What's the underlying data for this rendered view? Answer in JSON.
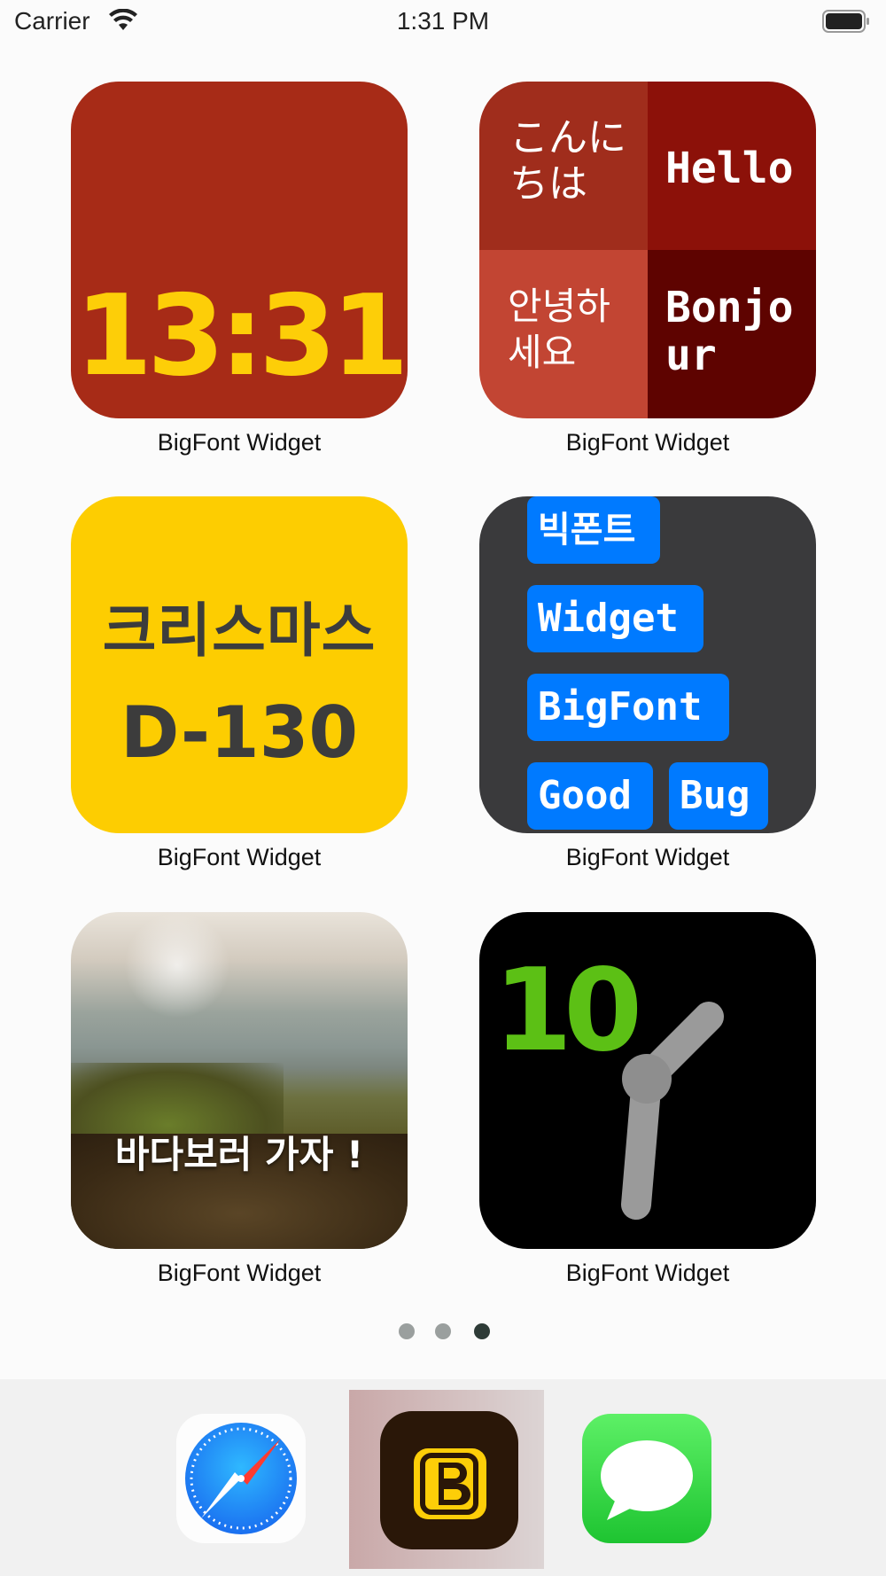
{
  "status_bar": {
    "carrier": "Carrier",
    "time": "1:31 PM"
  },
  "widgets": [
    {
      "label": "BigFont Widget",
      "time": "13:31"
    },
    {
      "label": "BigFont Widget",
      "jp_line1": "こんに",
      "jp_line2": "ちは",
      "en": "Hello",
      "ko_line1": "안녕하",
      "ko_line2": "세요",
      "fr_line1": "Bonjo",
      "fr_line2": "ur"
    },
    {
      "label": "BigFont Widget",
      "line1": "크리스마스",
      "line2": "D-130"
    },
    {
      "label": "BigFont Widget",
      "tags": [
        "빅폰트",
        "Widget",
        "BigFont",
        "Good",
        "Bug"
      ]
    },
    {
      "label": "BigFont Widget",
      "caption": "바다보러 가자 !"
    },
    {
      "label": "BigFont Widget",
      "hour": "10"
    }
  ],
  "page_dots": {
    "count": 3,
    "active": 3
  },
  "dock": {
    "apps": [
      "safari-icon",
      "bigfont-app-icon",
      "messages-icon"
    ]
  },
  "colors": {
    "clock_bg": "#a72b17",
    "clock_text": "#fdce08",
    "tag_blue": "#007aff",
    "analog_hour_green": "#5cc015"
  }
}
